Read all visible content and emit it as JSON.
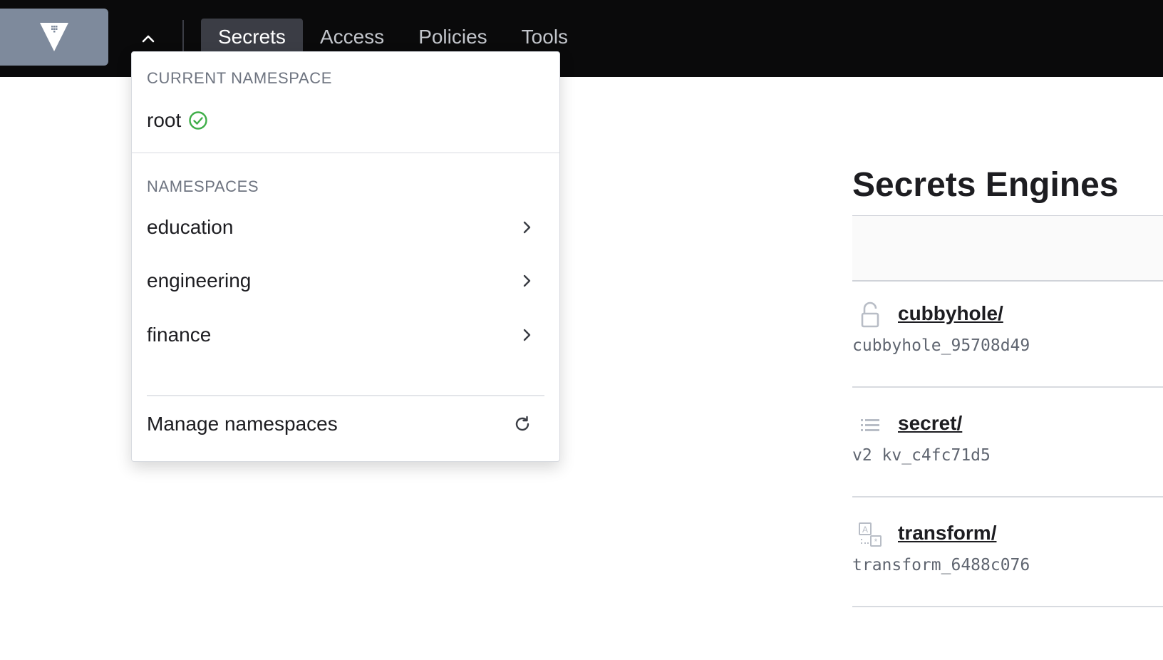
{
  "topbar": {
    "nav": [
      {
        "label": "Secrets",
        "active": true
      },
      {
        "label": "Access",
        "active": false
      },
      {
        "label": "Policies",
        "active": false
      },
      {
        "label": "Tools",
        "active": false
      }
    ]
  },
  "namespace_menu": {
    "current_heading": "CURRENT NAMESPACE",
    "current_name": "root",
    "namespaces_heading": "NAMESPACES",
    "namespaces": [
      "education",
      "engineering",
      "finance"
    ],
    "manage_label": "Manage namespaces"
  },
  "main": {
    "title": "Secrets Engines",
    "engines": [
      {
        "name": "cubbyhole/",
        "detail": "cubbyhole_95708d49",
        "icon": "lock-icon"
      },
      {
        "name": "secret/",
        "detail": "v2 kv_c4fc71d5",
        "icon": "list-icon"
      },
      {
        "name": "transform/",
        "detail": "transform_6488c076",
        "icon": "transform-icon"
      }
    ]
  },
  "colors": {
    "topbar_bg": "#0a0a0b",
    "logo_bg": "#7e8a9c",
    "active_tab_bg": "#3b3d45",
    "check_green": "#3fae49"
  }
}
